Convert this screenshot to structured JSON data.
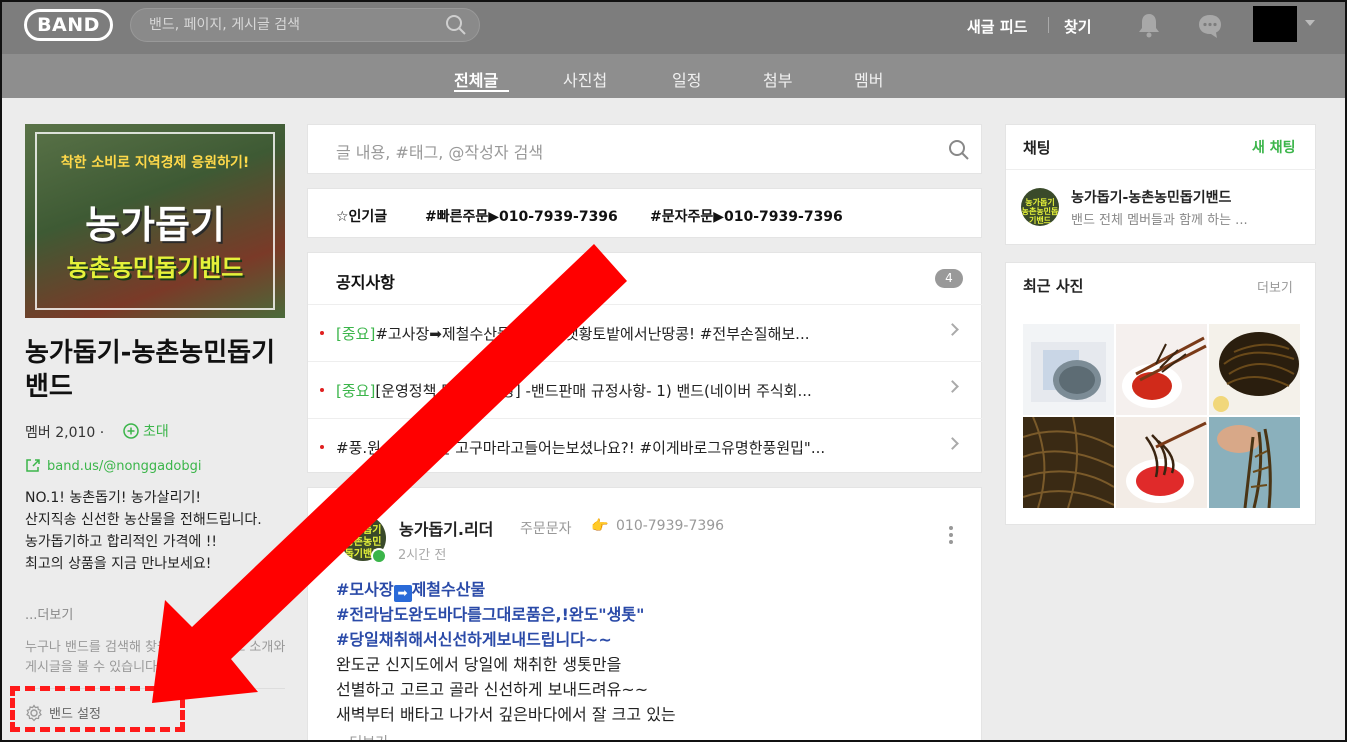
{
  "header": {
    "logo": "BAND",
    "search_placeholder": "밴드, 페이지, 게시글 검색",
    "links": [
      "새글 피드",
      "찾기"
    ]
  },
  "tabs": [
    {
      "label": "전체글",
      "active": true
    },
    {
      "label": "사진첩",
      "active": false
    },
    {
      "label": "일정",
      "active": false
    },
    {
      "label": "첨부",
      "active": false
    },
    {
      "label": "멤버",
      "active": false
    }
  ],
  "left": {
    "cover_slogan": "착한 소비로 지역경제 응원하기!",
    "cover_title": "농가돕기",
    "cover_subtitle": "농촌농민돕기밴드",
    "band_name": "농가돕기-농촌농민돕기밴드",
    "member_label": "멤버 2,010 ·",
    "invite_label": "초대",
    "band_url": "band.us/@nonggadobgi",
    "description": [
      "NO.1! 농촌돕기! 농가살리기!",
      "산지직송 신선한 농산물을 전해드립니다.",
      "농가돕기하고 합리적인 가격에 !!",
      "최고의 상품을 지금 만나보세요!"
    ],
    "more_label": "...더보기",
    "public_note": "누구나 밴드를 검색해 찾을 수 있고, 밴드 소개와 게시글을 볼 수 있습니다.",
    "settings_label": "밴드 설정"
  },
  "center": {
    "post_search_placeholder": "글 내용, #태그, @작성자 검색",
    "tags": [
      "☆인기글",
      "#빠른주문▶010-7939-7396",
      "#문자주문▶010-7939-7396"
    ],
    "notice_title": "공지사항",
    "notice_count": "4",
    "notices": [
      {
        "tag": "[중요]",
        "text": "#고사장➡제철수산물#국내산햇황토밭에서난땅콩! #전부손질해보..."
      },
      {
        "tag": "[중요]",
        "text": "[운영정책 및 공지사항] -밴드판매 규정사항- 1) 밴드(네이버 주식회..."
      },
      {
        "tag": "",
        "text": "#풍.원.두.내 이런 고구마라고들어는보셨나요?! #이게바로그유명한풍원밉\"..."
      }
    ],
    "post": {
      "avatar_text": "농가돕기 농촌농민 돕기밴드",
      "author": "농가돕기.리더",
      "order_label": "주문문자",
      "hand": "👉",
      "phone": "010-7939-7396",
      "time": "2시간 전",
      "hashtags": [
        "#모사장",
        "제철수산물",
        "#전라남도완도바다를그대로품은,!완도\"생톳\"",
        "#당일채취해서신선하게보내드립니다~~"
      ],
      "arrow_glyph": "➡",
      "lines": [
        "완도군 신지도에서 당일에 채취한 생톳만을",
        "선별하고 고르고 골라 신선하게 보내드려유~~",
        "새벽부터 배타고 나가서 깊은바다에서 잘 크고 있는"
      ],
      "more_label": "...더보기"
    }
  },
  "right": {
    "chat_title": "채팅",
    "new_chat": "새 채팅",
    "chat_avatar_text": "농가돕기 농촌농민돕기밴드",
    "chat_name": "농가돕기-농촌농민돕기밴드",
    "chat_sub": "밴드 전체 멤버들과 함께 하는 ...",
    "photos_title": "최근 사진",
    "photos_more": "더보기"
  },
  "colors": {
    "accent_green": "#3bb54a",
    "topbar": "#7d7d7d",
    "tabbar": "#8e8e8e",
    "annotation_red": "#ff1a1a"
  }
}
